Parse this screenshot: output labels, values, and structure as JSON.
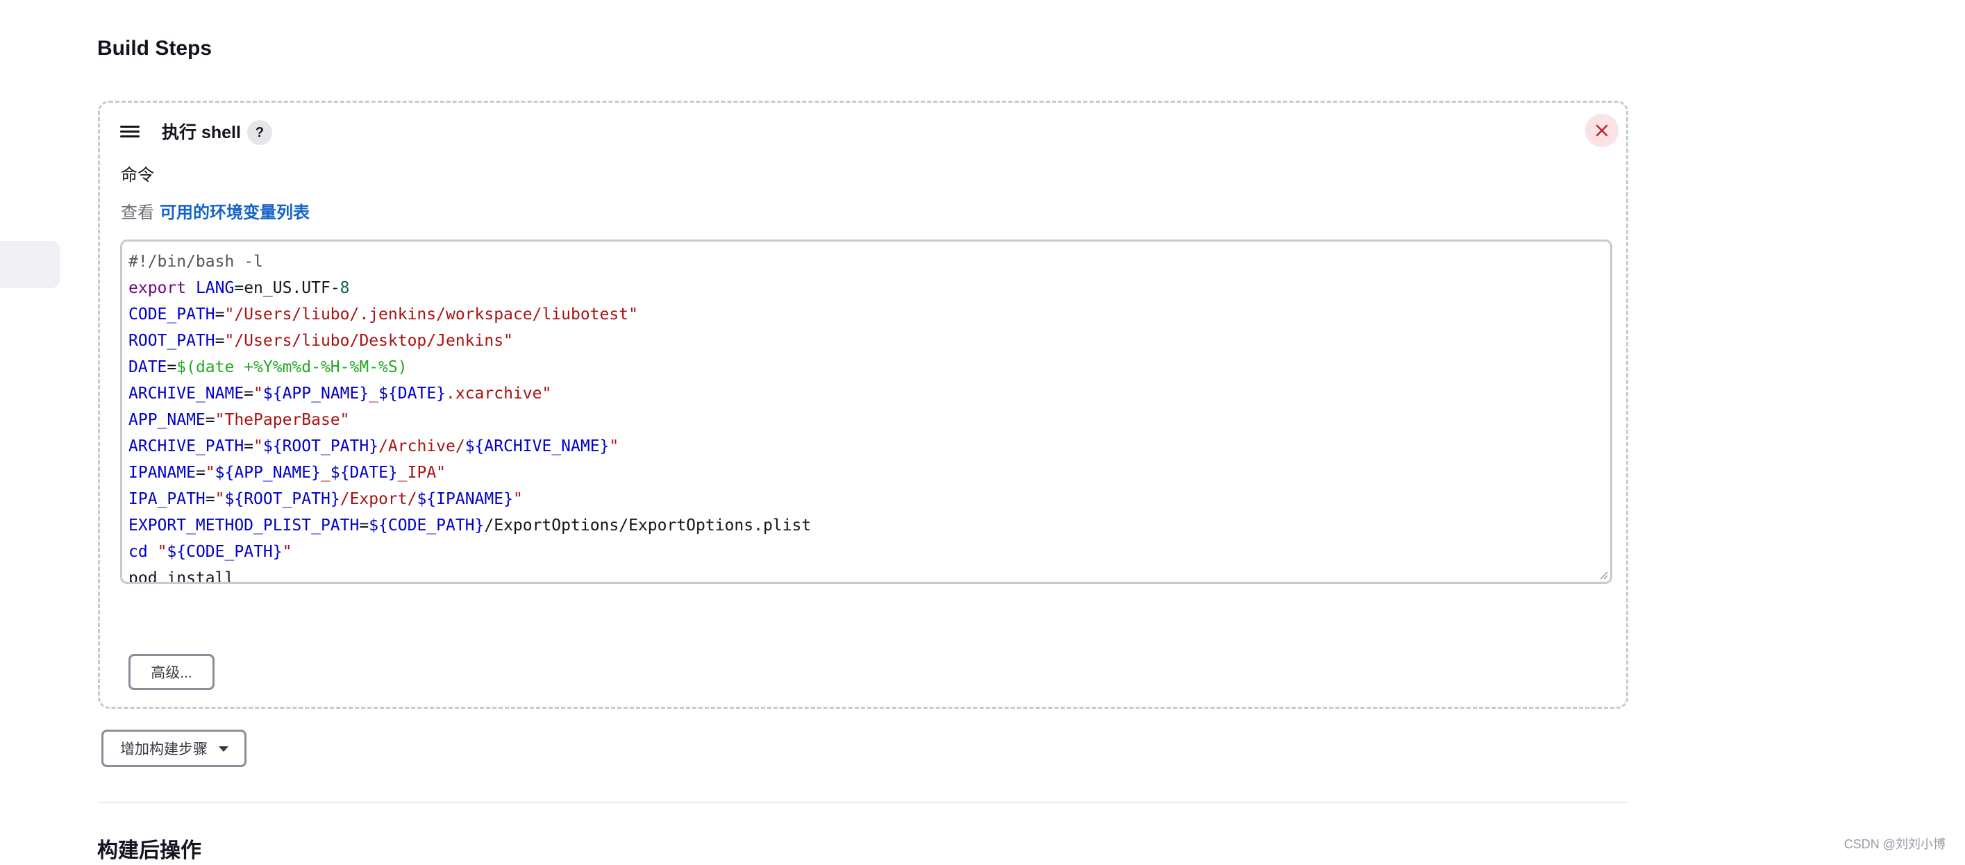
{
  "page": {
    "section_title": "Build Steps",
    "next_section_title": "构建后操作",
    "watermark": "CSDN @刘刘小博"
  },
  "step": {
    "title": "执行 shell",
    "help": "?",
    "close_icon": "close-icon",
    "field_label": "命令",
    "env_prefix": "查看",
    "env_link": "可用的环境变量列表",
    "advanced_label": "高级...",
    "code_lines": [
      [
        {
          "t": "#!/bin/bash -l",
          "c": "#555555"
        }
      ],
      [
        {
          "t": "export",
          "c": "#770088"
        },
        {
          "t": " ",
          "c": "#14141f"
        },
        {
          "t": "LANG",
          "c": "#0000cc"
        },
        {
          "t": "=en_US.UTF-",
          "c": "#14141f"
        },
        {
          "t": "8",
          "c": "#116644"
        }
      ],
      [
        {
          "t": "CODE_PATH",
          "c": "#0000cc"
        },
        {
          "t": "=",
          "c": "#14141f"
        },
        {
          "t": "\"/Users/liubo/.jenkins/workspace/liubotest\"",
          "c": "#aa1111"
        }
      ],
      [
        {
          "t": "ROOT_PATH",
          "c": "#0000cc"
        },
        {
          "t": "=",
          "c": "#14141f"
        },
        {
          "t": "\"/Users/liubo/Desktop/Jenkins\"",
          "c": "#aa1111"
        }
      ],
      [
        {
          "t": "DATE",
          "c": "#0000cc"
        },
        {
          "t": "=",
          "c": "#14141f"
        },
        {
          "t": "$(date +%Y%m%d-%H-%M-%S)",
          "c": "#22aa22"
        }
      ],
      [
        {
          "t": "ARCHIVE_NAME",
          "c": "#0000cc"
        },
        {
          "t": "=",
          "c": "#14141f"
        },
        {
          "t": "\"",
          "c": "#aa1111"
        },
        {
          "t": "${APP_NAME}",
          "c": "#0000cc"
        },
        {
          "t": "_",
          "c": "#aa1111"
        },
        {
          "t": "${DATE}",
          "c": "#0000cc"
        },
        {
          "t": ".xcarchive\"",
          "c": "#aa1111"
        }
      ],
      [
        {
          "t": "APP_NAME",
          "c": "#0000cc"
        },
        {
          "t": "=",
          "c": "#14141f"
        },
        {
          "t": "\"ThePaperBase\"",
          "c": "#aa1111"
        }
      ],
      [
        {
          "t": "ARCHIVE_PATH",
          "c": "#0000cc"
        },
        {
          "t": "=",
          "c": "#14141f"
        },
        {
          "t": "\"",
          "c": "#aa1111"
        },
        {
          "t": "${ROOT_PATH}",
          "c": "#0000cc"
        },
        {
          "t": "/Archive/",
          "c": "#aa1111"
        },
        {
          "t": "${ARCHIVE_NAME}",
          "c": "#0000cc"
        },
        {
          "t": "\"",
          "c": "#aa1111"
        }
      ],
      [
        {
          "t": "IPANAME",
          "c": "#0000cc"
        },
        {
          "t": "=",
          "c": "#14141f"
        },
        {
          "t": "\"",
          "c": "#aa1111"
        },
        {
          "t": "${APP_NAME}",
          "c": "#0000cc"
        },
        {
          "t": "_",
          "c": "#aa1111"
        },
        {
          "t": "${DATE}",
          "c": "#0000cc"
        },
        {
          "t": "_IPA\"",
          "c": "#aa1111"
        }
      ],
      [
        {
          "t": "IPA_PATH",
          "c": "#0000cc"
        },
        {
          "t": "=",
          "c": "#14141f"
        },
        {
          "t": "\"",
          "c": "#aa1111"
        },
        {
          "t": "${ROOT_PATH}",
          "c": "#0000cc"
        },
        {
          "t": "/Export/",
          "c": "#aa1111"
        },
        {
          "t": "${IPANAME}",
          "c": "#0000cc"
        },
        {
          "t": "\"",
          "c": "#aa1111"
        }
      ],
      [
        {
          "t": "EXPORT_METHOD_PLIST_PATH",
          "c": "#0000cc"
        },
        {
          "t": "=",
          "c": "#14141f"
        },
        {
          "t": "${CODE_PATH}",
          "c": "#0000cc"
        },
        {
          "t": "/ExportOptions/ExportOptions.plist",
          "c": "#14141f"
        }
      ],
      [
        {
          "t": "cd",
          "c": "#0000cc"
        },
        {
          "t": " ",
          "c": "#14141f"
        },
        {
          "t": "\"",
          "c": "#aa1111"
        },
        {
          "t": "${CODE_PATH}",
          "c": "#0000cc"
        },
        {
          "t": "\"",
          "c": "#aa1111"
        }
      ],
      [
        {
          "t": "pod install",
          "c": "#14141f"
        }
      ]
    ]
  },
  "add_step": {
    "label": "增加构建步骤",
    "caret_icon": "caret-down-icon"
  },
  "colors": {
    "link": "#1764c8",
    "close_bg": "#fbe3e5",
    "close_fg": "#c0223a",
    "dashed_border": "#c9c9d2"
  }
}
